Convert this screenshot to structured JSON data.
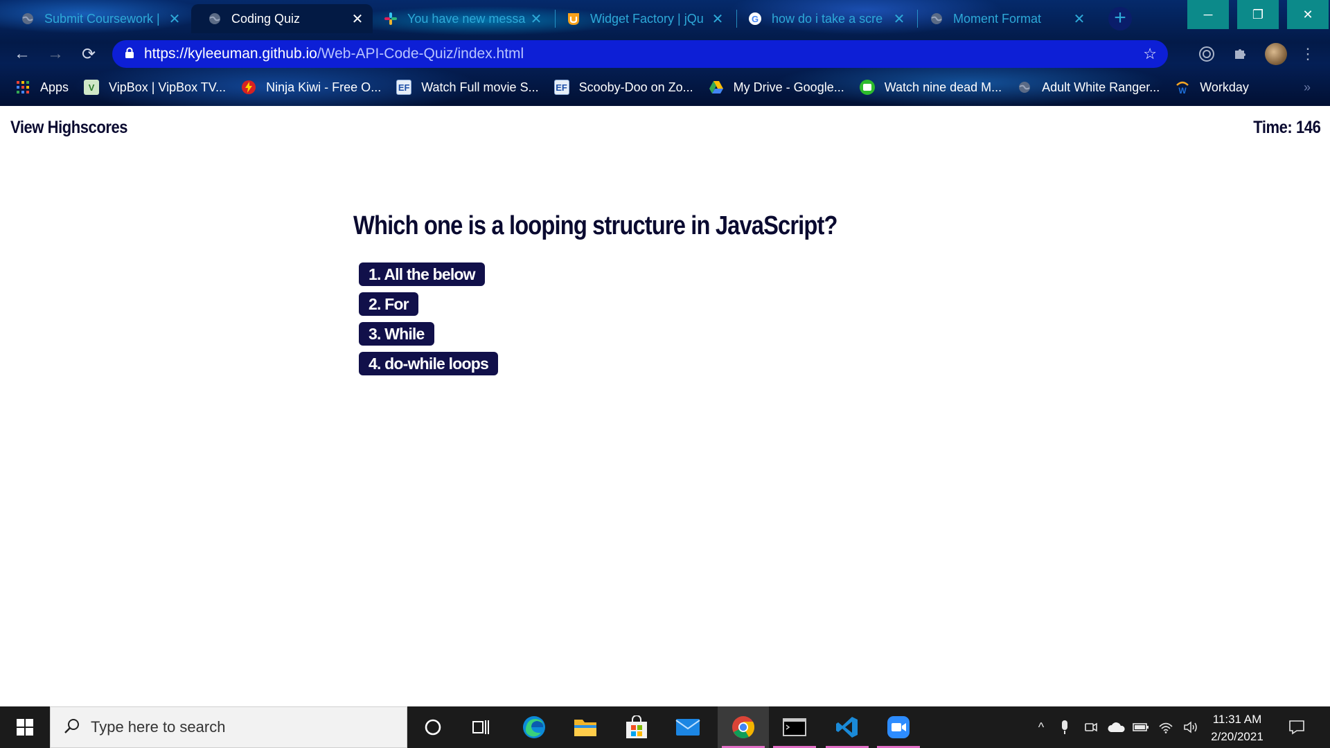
{
  "browser": {
    "tabs": [
      {
        "title": "Submit Coursework |",
        "icon": "globe-icon"
      },
      {
        "title": "Coding Quiz",
        "icon": "globe-icon"
      },
      {
        "title": "You have new messa",
        "icon": "slack-icon"
      },
      {
        "title": "Widget Factory | jQu",
        "icon": "jquery-ui-icon"
      },
      {
        "title": "how do i take a scre",
        "icon": "google-icon"
      },
      {
        "title": "Moment Format",
        "icon": "globe-icon"
      }
    ],
    "url_host": "https://kyleeuman.github.io",
    "url_path": "/Web-API-Code-Quiz/index.html",
    "bookmarks": [
      {
        "label": "Apps",
        "icon": "apps-grid-icon"
      },
      {
        "label": "VipBox | VipBox TV...",
        "icon": "vipbox-icon"
      },
      {
        "label": "Ninja Kiwi - Free O...",
        "icon": "ninja-kiwi-icon"
      },
      {
        "label": "Watch Full movie S...",
        "icon": "movie-site-icon"
      },
      {
        "label": "Scooby-Doo on Zo...",
        "icon": "movie-site-icon"
      },
      {
        "label": "My Drive - Google...",
        "icon": "google-drive-icon"
      },
      {
        "label": "Watch nine dead M...",
        "icon": "green-site-icon"
      },
      {
        "label": "Adult White Ranger...",
        "icon": "globe-icon"
      },
      {
        "label": "Workday",
        "icon": "workday-icon"
      }
    ]
  },
  "page": {
    "highscores_link": "View Highscores",
    "timer": "Time: 146",
    "question": "Which one is a looping structure in JavaScript?",
    "answers": [
      "1. All the below",
      "2. For",
      "3. While",
      "4. do-while loops"
    ]
  },
  "taskbar": {
    "search_placeholder": "Type here to search",
    "time": "11:31 AM",
    "date": "2/20/2021",
    "apps": [
      "cortana",
      "task-view",
      "edge",
      "file-explorer",
      "microsoft-store",
      "mail",
      "chrome",
      "terminal",
      "vscode",
      "zoom"
    ]
  },
  "colors": {
    "answer_bg": "#11104a",
    "text_dark": "#0a0a30",
    "omnibox": "#0d1fd6",
    "tab_text": "#2ea9d8"
  }
}
